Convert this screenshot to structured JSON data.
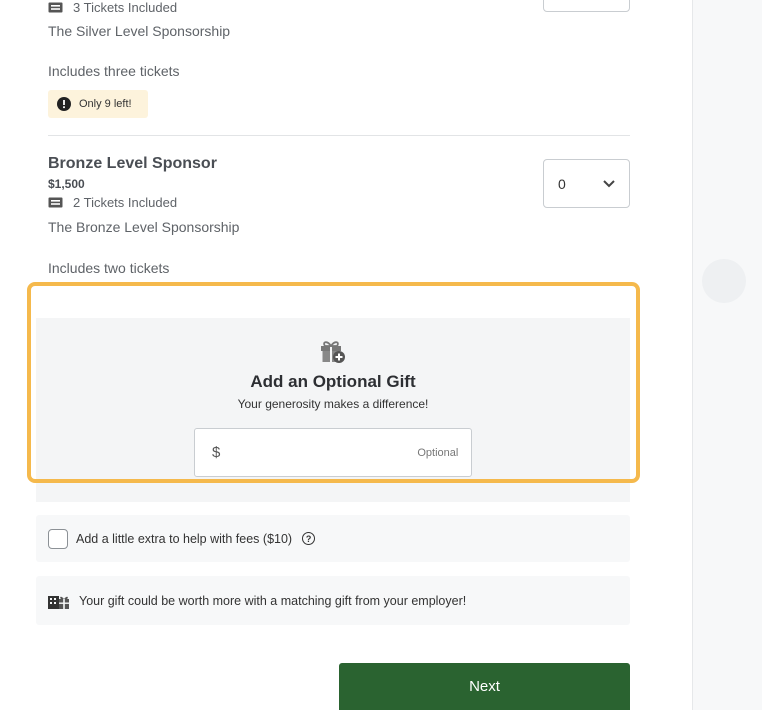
{
  "silver": {
    "tickets_included": "3 Tickets Included",
    "name_line": "The Silver Level Sponsorship",
    "description": "Includes three tickets",
    "stock_warning": "Only 9 left!"
  },
  "bronze": {
    "title": "Bronze Level Sponsor",
    "price": "$1,500",
    "tickets_included": "2 Tickets Included",
    "name_line": "The Bronze Level Sponsorship",
    "description": "Includes two tickets",
    "quantity": "0"
  },
  "gift": {
    "title": "Add an Optional Gift",
    "subtitle": "Your generosity makes a difference!",
    "currency": "$",
    "amount_value": "",
    "optional_label": "Optional"
  },
  "fees": {
    "label": "Add a little extra to help with fees ($10)",
    "help_glyph": "?"
  },
  "matching": {
    "label": "Your gift could be worth more with a matching gift from your employer!"
  },
  "actions": {
    "next_label": "Next"
  },
  "colors": {
    "primary_button": "#2a6330",
    "highlight_border": "#f5b94c",
    "warning_bg": "#fdf3dc"
  },
  "icons": {
    "ticket": "ticket-icon",
    "warning": "alert-icon",
    "gift": "gift-add-icon",
    "chevron": "chevron-down-icon",
    "help": "help-circle-icon",
    "matching": "matching-gift-icon"
  }
}
